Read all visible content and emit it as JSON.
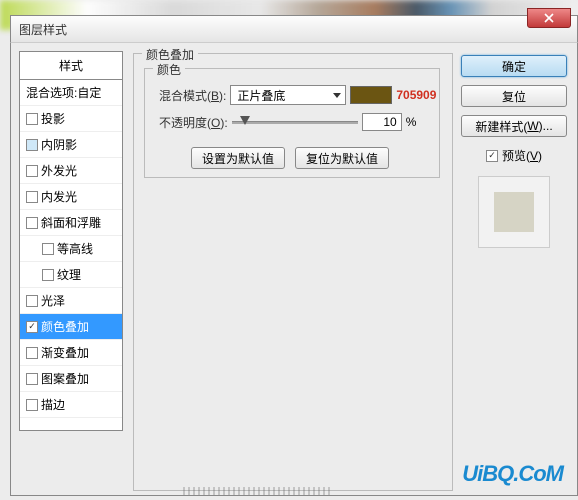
{
  "window": {
    "title": "图层样式"
  },
  "sidebar": {
    "header": "样式",
    "blending": "混合选项:自定",
    "items": [
      {
        "label": "投影",
        "checked": false
      },
      {
        "label": "内阴影",
        "checked": false,
        "innerShadow": true
      },
      {
        "label": "外发光",
        "checked": false
      },
      {
        "label": "内发光",
        "checked": false
      },
      {
        "label": "斜面和浮雕",
        "checked": false
      },
      {
        "label": "等高线",
        "checked": false,
        "indent": true
      },
      {
        "label": "纹理",
        "checked": false,
        "indent": true
      },
      {
        "label": "光泽",
        "checked": false
      },
      {
        "label": "颜色叠加",
        "checked": true,
        "selected": true
      },
      {
        "label": "渐变叠加",
        "checked": false
      },
      {
        "label": "图案叠加",
        "checked": false
      },
      {
        "label": "描边",
        "checked": false
      }
    ]
  },
  "main": {
    "group_title": "颜色叠加",
    "color_group": "颜色",
    "blend_label_pre": "混合模式(",
    "blend_hotkey": "B",
    "blend_label_post": "):",
    "blend_value": "正片叠底",
    "hex": "705909",
    "opacity_label_pre": "不透明度(",
    "opacity_hotkey": "O",
    "opacity_label_post": "):",
    "opacity_value": "10",
    "opacity_unit": "%",
    "set_default": "设置为默认值",
    "reset_default": "复位为默认值"
  },
  "right": {
    "ok": "确定",
    "reset": "复位",
    "new_style_pre": "新建样式(",
    "new_style_hot": "W",
    "new_style_post": ")...",
    "preview_pre": "预览(",
    "preview_hot": "V",
    "preview_post": ")"
  },
  "watermark": "UiBQ.CoM"
}
